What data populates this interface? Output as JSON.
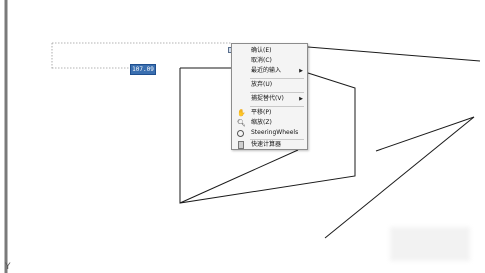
{
  "canvas": {
    "dynamic_input_value": "107.09",
    "ucs_axis_label": "Y"
  },
  "context_menu": {
    "items": [
      {
        "label": "确认(E)"
      },
      {
        "label": "取消(C)"
      },
      {
        "label": "最近的输入"
      },
      {
        "label": "放弃(U)"
      },
      {
        "label": "捕捉替代(V)"
      },
      {
        "label": "平移(P)",
        "icon": "pan-hand-icon"
      },
      {
        "label": "缩放(Z)",
        "icon": "zoom-magnifier-icon"
      },
      {
        "label": "SteeringWheels",
        "icon": "steering-wheel-icon"
      },
      {
        "label": "快速计算器",
        "icon": "calculator-icon"
      }
    ]
  }
}
